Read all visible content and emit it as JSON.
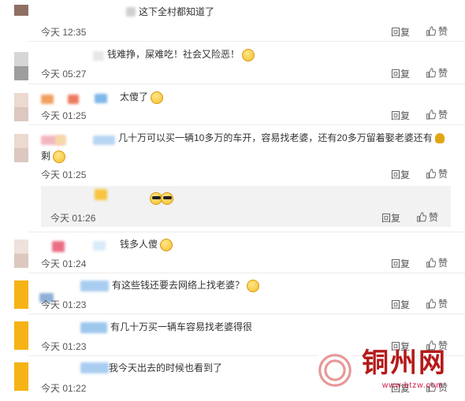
{
  "ui": {
    "reply_label": "回复",
    "like_label": "赞"
  },
  "comments": [
    {
      "text": "这下全村都知道了",
      "time": "今天 12:35"
    },
    {
      "text": "钱难挣，屎难吃！社会又险恶！",
      "time": "今天 05:27"
    },
    {
      "text": "太傻了",
      "time": "今天 01:25"
    },
    {
      "text": "几十万可以买一辆10多万的车开，容易找老婆，还有20多万留着娶老婆还有",
      "text_cont": "剩",
      "time": "今天 01:25"
    },
    {
      "time": "今天 01:26"
    },
    {
      "text": "钱多人傻",
      "time": "今天 01:24"
    },
    {
      "text": "有这些钱还要去网络上找老婆？",
      "time": "今天 01:23"
    },
    {
      "text": "有几十万买一辆车容易找老婆得很",
      "time": "今天 01:23"
    },
    {
      "text": "我今天出去的时候也看到了",
      "time": "今天 01:22"
    }
  ],
  "watermark": {
    "text": "铜州网",
    "url": "www.btzw.com"
  }
}
